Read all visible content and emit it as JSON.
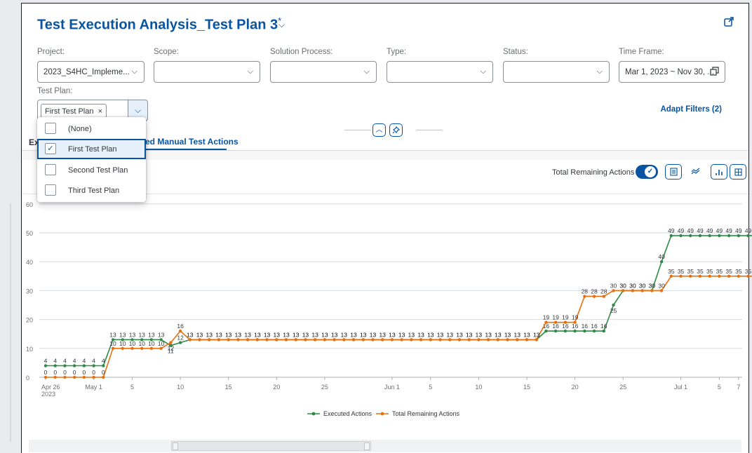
{
  "header": {
    "title": "Test Execution Analysis_Test Plan 3",
    "title_marker": "*"
  },
  "filters": [
    {
      "label": "Project:",
      "value": "2023_S4HC_Impleme..."
    },
    {
      "label": "Scope:",
      "value": ""
    },
    {
      "label": "Solution Process:",
      "value": ""
    },
    {
      "label": "Type:",
      "value": ""
    },
    {
      "label": "Status:",
      "value": ""
    },
    {
      "label": "Time Frame:",
      "value": "Mar 1, 2023 ~ Nov 30, ..."
    }
  ],
  "test_plan": {
    "label": "Test Plan:",
    "token": "First Test Plan",
    "token_close": "×",
    "options": [
      {
        "label": "(None)",
        "checked": false
      },
      {
        "label": "First Test Plan",
        "checked": true
      },
      {
        "label": "Second Test Plan",
        "checked": false
      },
      {
        "label": "Third Test Plan",
        "checked": false
      }
    ]
  },
  "adapt_filters": "Adapt Filters (2)",
  "tabs": {
    "first_partial": "Ex",
    "active_partial": "ed Manual Test Actions"
  },
  "chart_toolbar": {
    "toggle_label": "Total Remaining Actions",
    "toggle_on": true
  },
  "colors": {
    "accent": "#0854a0",
    "executed": "#2e8b47",
    "remaining": "#e8700f"
  },
  "chart_data": {
    "type": "line",
    "ylim": [
      0,
      60
    ],
    "yticks": [
      0,
      10,
      20,
      30,
      40,
      50,
      60
    ],
    "xticks": [
      {
        "i": 0,
        "label": "Apr 26",
        "sub": "2023"
      },
      {
        "i": 5,
        "label": "May 1"
      },
      {
        "i": 9,
        "label": "5"
      },
      {
        "i": 14,
        "label": "10"
      },
      {
        "i": 19,
        "label": "15"
      },
      {
        "i": 24,
        "label": "20"
      },
      {
        "i": 29,
        "label": "25"
      },
      {
        "i": 36,
        "label": "Jun 1"
      },
      {
        "i": 40,
        "label": "5"
      },
      {
        "i": 45,
        "label": "10"
      },
      {
        "i": 50,
        "label": "15"
      },
      {
        "i": 55,
        "label": "20"
      },
      {
        "i": 60,
        "label": "25"
      },
      {
        "i": 66,
        "label": "Jul 1"
      },
      {
        "i": 70,
        "label": "5"
      },
      {
        "i": 72,
        "label": "7"
      }
    ],
    "series": [
      {
        "name": "Executed Actions",
        "values": [
          4,
          4,
          4,
          4,
          4,
          4,
          4,
          13,
          13,
          13,
          13,
          13,
          13,
          11,
          12,
          13,
          13,
          13,
          13,
          13,
          13,
          13,
          13,
          13,
          13,
          13,
          13,
          13,
          13,
          13,
          13,
          13,
          13,
          13,
          13,
          13,
          13,
          13,
          13,
          13,
          13,
          13,
          13,
          13,
          13,
          13,
          13,
          13,
          13,
          13,
          13,
          13,
          16,
          16,
          16,
          16,
          16,
          16,
          16,
          25,
          30,
          30,
          30,
          30,
          40,
          49,
          49,
          49,
          49,
          49,
          49,
          49,
          49,
          49,
          49,
          49,
          49
        ]
      },
      {
        "name": "Total Remaining Actions",
        "values": [
          0,
          0,
          0,
          0,
          0,
          0,
          0,
          10,
          10,
          10,
          10,
          10,
          10,
          12,
          16,
          13,
          13,
          13,
          13,
          13,
          13,
          13,
          13,
          13,
          13,
          13,
          13,
          13,
          13,
          13,
          13,
          13,
          13,
          13,
          13,
          13,
          13,
          13,
          13,
          13,
          13,
          13,
          13,
          13,
          13,
          13,
          13,
          13,
          13,
          13,
          13,
          13,
          19,
          19,
          19,
          19,
          28,
          28,
          28,
          30,
          30,
          30,
          30,
          30,
          30,
          35,
          35,
          35,
          35,
          35,
          35,
          35,
          35,
          35,
          35,
          35,
          35
        ]
      }
    ]
  }
}
